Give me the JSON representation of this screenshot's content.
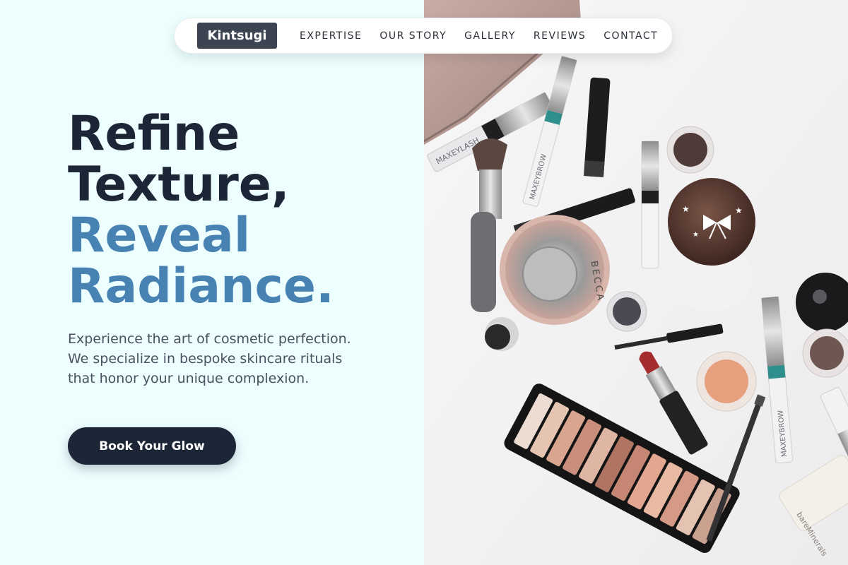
{
  "nav": {
    "logo": "Kintsugi",
    "links": [
      "EXPERTISE",
      "OUR STORY",
      "GALLERY",
      "REVIEWS",
      "CONTACT"
    ]
  },
  "hero": {
    "title_line1": "Refine",
    "title_line2": "Texture,",
    "title_line3": "Reveal",
    "title_line4": "Radiance.",
    "description": "Experience the art of cosmetic perfection. We specialize in bespoke skincare rituals that honor your unique complexion.",
    "cta_label": "Book Your Glow"
  },
  "photo": {
    "brand_mascara": "MAXEYLASH",
    "brand_brow": "MAXEYBROW",
    "brand_compact": "BECCA",
    "brand_tube": "bareMinerals"
  },
  "colors": {
    "left_bg": "#ecfefe",
    "dark_text": "#1c2636",
    "accent_text": "#4882b2",
    "logo_bg": "#3c4452"
  }
}
